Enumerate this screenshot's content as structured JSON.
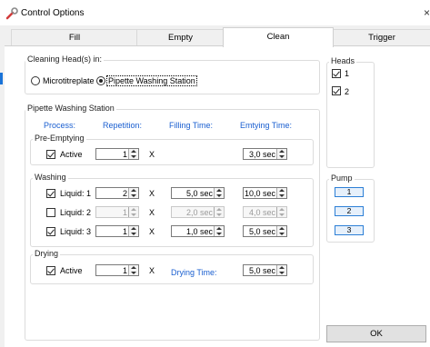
{
  "window": {
    "title": "Control Options",
    "close_glyph": "×"
  },
  "tabs": [
    "Fill",
    "Empty",
    "Clean",
    "Trigger"
  ],
  "cleaning_heads": {
    "label": "Cleaning Head(s) in:",
    "options": [
      "Microtitreplate",
      "Pipette Washing Station"
    ],
    "selected": "Pipette Washing Station"
  },
  "station": {
    "label": "Pipette Washing Station",
    "headers": {
      "process": "Process:",
      "repetition": "Repetition:",
      "filling": "Filling Time:",
      "emptying": "Emtying Time:"
    },
    "multiply": "X",
    "pre_emptying": {
      "label": "Pre-Emptying",
      "row": {
        "name": "Active",
        "checked": true,
        "repetition": "1",
        "emptying": "3,0 sec"
      }
    },
    "washing": {
      "label": "Washing",
      "rows": [
        {
          "name": "Liquid: 1",
          "checked": true,
          "repetition": "2",
          "filling": "5,0 sec",
          "emptying": "10,0 sec"
        },
        {
          "name": "Liquid: 2",
          "checked": false,
          "repetition": "1",
          "filling": "2,0 sec",
          "emptying": "4,0 sec"
        },
        {
          "name": "Liquid: 3",
          "checked": true,
          "repetition": "1",
          "filling": "1,0 sec",
          "emptying": "5,0 sec"
        }
      ]
    },
    "drying": {
      "label": "Drying",
      "row": {
        "name": "Active",
        "checked": true,
        "repetition": "1",
        "time_label": "Drying Time:",
        "time": "5,0 sec"
      }
    }
  },
  "heads": {
    "label": "Heads",
    "items": [
      {
        "label": "1",
        "checked": true
      },
      {
        "label": "2",
        "checked": true
      }
    ]
  },
  "pump": {
    "label": "Pump",
    "buttons": [
      "1",
      "2",
      "3"
    ]
  },
  "ok_label": "OK",
  "colors": {
    "accent": "#1a73d8",
    "header_blue": "#1a5fd0",
    "pump_border": "#2c7fd6"
  }
}
